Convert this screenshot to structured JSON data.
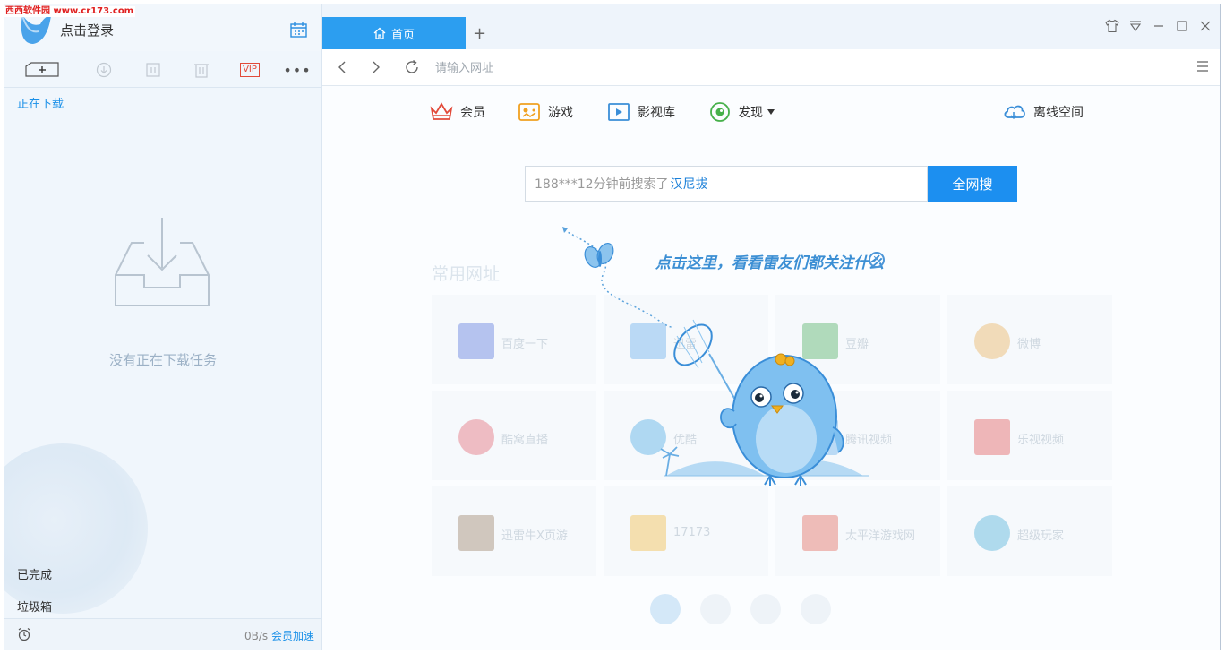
{
  "watermark": "西西软件园 www.cr173.com",
  "left": {
    "login_label": "点击登录",
    "section_downloading": "正在下载",
    "empty_text": "没有正在下载任务",
    "done_label": "已完成",
    "trash_label": "垃圾箱",
    "speed_value": "0B/s",
    "vip_speed_label": "会员加速",
    "toolbar_vip": "VIP"
  },
  "tabs": [
    {
      "label": "首页",
      "icon": "home-icon",
      "active": true
    }
  ],
  "addressbar": {
    "placeholder": "请输入网址"
  },
  "quick_links": {
    "member": "会员",
    "games": "游戏",
    "video": "影视库",
    "discover": "发现",
    "offline": "离线空间"
  },
  "search": {
    "hint_prefix": "188***12分钟前搜索了",
    "hint_keyword": "汉尼拔",
    "button": "全网搜"
  },
  "promo": {
    "text": "点击这里，看看雷友们都关注什么"
  },
  "sites": {
    "title": "常用网址",
    "items": [
      {
        "label": "百度一下",
        "color": "#3b5fd8"
      },
      {
        "label": "迅雷",
        "color": "#4a9de8"
      },
      {
        "label": "豆瓣",
        "color": "#2ea043"
      },
      {
        "label": "微博",
        "color": "#e8a23b"
      },
      {
        "label": "酷窝直播",
        "color": "#e04a5a"
      },
      {
        "label": "优酷",
        "color": "#2a9ae0"
      },
      {
        "label": "腾讯视频",
        "color": "#4aa0e8"
      },
      {
        "label": "乐视视频",
        "color": "#e03a3a"
      },
      {
        "label": "迅雷牛X页游",
        "color": "#8a6a4a"
      },
      {
        "label": "17173",
        "color": "#f0b020"
      },
      {
        "label": "太平洋游戏网",
        "color": "#e04a3a"
      },
      {
        "label": "超级玩家",
        "color": "#2aa0d0"
      }
    ]
  },
  "colors": {
    "accent": "#1c8ff0",
    "tab_active": "#2c9ef0"
  }
}
